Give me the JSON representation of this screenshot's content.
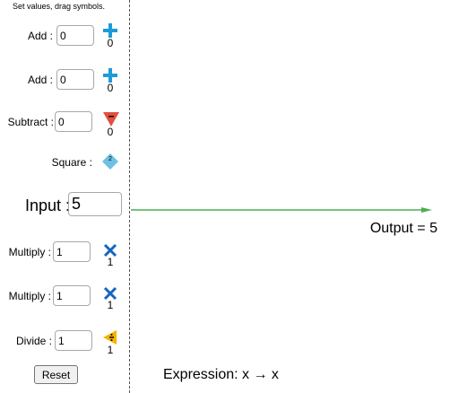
{
  "instructions": "Set values, drag symbols.",
  "ops": [
    {
      "label": "Add :",
      "value": "0",
      "symbol": "plus-icon",
      "count": "0",
      "color": "#1e9bd7"
    },
    {
      "label": "Add :",
      "value": "0",
      "symbol": "plus-icon",
      "count": "0",
      "color": "#1e9bd7"
    },
    {
      "label": "Subtract :",
      "value": "0",
      "symbol": "minus-triangle-icon",
      "count": "0",
      "color": "#e05040"
    },
    {
      "label": "Square :",
      "symbol": "square-diamond-icon",
      "badge": "2",
      "color": "#6ec1e4"
    },
    {
      "label": "Multiply :",
      "value": "1",
      "symbol": "times-icon",
      "count": "1",
      "color": "#1565c0"
    },
    {
      "label": "Multiply :",
      "value": "1",
      "symbol": "times-icon",
      "count": "1",
      "color": "#1565c0"
    },
    {
      "label": "Divide :",
      "value": "1",
      "symbol": "divide-triangle-icon",
      "count": "1",
      "color": "#f4b400"
    }
  ],
  "input": {
    "label": "Input :",
    "value": "5"
  },
  "output": "Output = 5",
  "expression": "Expression: x → x",
  "reset_label": "Reset",
  "colors": {
    "arrow": "#4caf50",
    "divider": "#555555"
  }
}
